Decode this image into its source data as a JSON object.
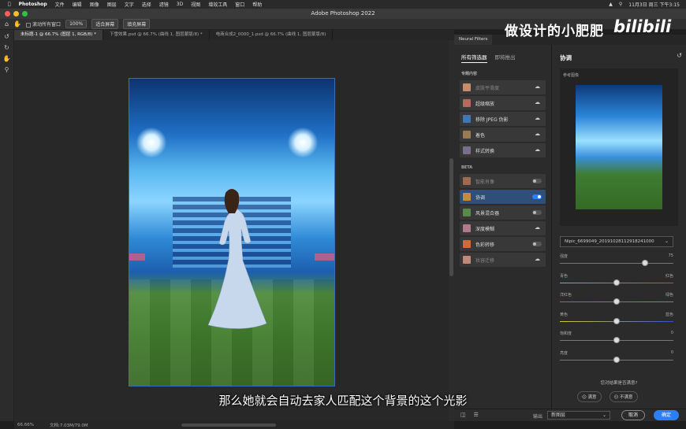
{
  "menubar": {
    "app": "Photoshop",
    "items": [
      "文件",
      "编辑",
      "图像",
      "图层",
      "文字",
      "选择",
      "滤镜",
      "3D",
      "视图",
      "增效工具",
      "窗口",
      "帮助"
    ],
    "clock": "11月3日 周三 下午3:15"
  },
  "window": {
    "title": "Adobe Photoshop 2022"
  },
  "options": {
    "scroll_all": "滚动所有窗口",
    "zoom": "100%",
    "fit_screen": "适合屏幕",
    "fill_screen": "填充屏幕"
  },
  "doc_tabs": [
    "未标题-1 @ 66.7% (图层 1, RGB/8) *",
    "下雪效果.psd @ 66.7% (曲线 1, 图层蒙版/8) *",
    "电商合成2_0000_1.psd @ 66.7% (曲线 1, 图层蒙版/8)"
  ],
  "status": {
    "zoom": "66.66%",
    "doc_size": "文档:7.03M/79.0M"
  },
  "neural": {
    "panel_tab": "Neural Filters",
    "tab_all": "所有筛选器",
    "tab_waitlist": "即将推出",
    "featured_label": "专题内容",
    "featured": [
      {
        "label": "皮肤平滑度",
        "thumb": "#c98c6a",
        "dim": true
      },
      {
        "label": "超级缩放",
        "thumb": "#b86a5a",
        "dim": false
      },
      {
        "label": "移除 JPEG 伪影",
        "thumb": "#3f78b5",
        "dim": false
      },
      {
        "label": "着色",
        "thumb": "#9a7a52",
        "dim": false
      },
      {
        "label": "样式转换",
        "thumb": "#7a6e8a",
        "dim": false
      }
    ],
    "beta_label": "BETA",
    "beta": [
      {
        "label": "智能肖像",
        "thumb": "#a06a50",
        "dim": true,
        "control": "toggle",
        "on": false
      },
      {
        "label": "协调",
        "thumb": "#c58a3a",
        "dim": false,
        "control": "toggle",
        "on": true,
        "selected": true
      },
      {
        "label": "风景混合器",
        "thumb": "#5a8a4a",
        "dim": false,
        "control": "toggle",
        "on": false
      },
      {
        "label": "深度模糊",
        "thumb": "#b07a8a",
        "dim": false,
        "control": "cloud"
      },
      {
        "label": "色彩转移",
        "thumb": "#d06a3a",
        "dim": false,
        "control": "toggle",
        "on": false
      },
      {
        "label": "妆容迁移",
        "thumb": "#c08a7a",
        "dim": true,
        "control": "cloud"
      }
    ],
    "detail_title": "协调",
    "reference_label": "参考图像",
    "reference_file": "Nipic_6699049_20191028112918241000",
    "sliders": [
      {
        "left": "强度",
        "right": "75",
        "value": 75,
        "min": 0,
        "max": 100
      },
      {
        "left": "青色",
        "right": "红色",
        "value": 0,
        "min": -50,
        "max": 50
      },
      {
        "left": "洋红色",
        "right": "绿色",
        "value": 0,
        "min": -50,
        "max": 50
      },
      {
        "left": "黄色",
        "right": "蓝色",
        "value": 0,
        "min": -50,
        "max": 50
      },
      {
        "left": "饱和度",
        "right": "0",
        "value": 0,
        "min": -50,
        "max": 50
      },
      {
        "left": "亮度",
        "right": "0",
        "value": 0,
        "min": -50,
        "max": 50
      }
    ],
    "feedback_q": "您对结果是否满意?",
    "fb_yes": "满意",
    "fb_no": "不满意",
    "output_label": "输出",
    "output_value": "新图层",
    "cancel": "取消",
    "ok": "确定"
  },
  "overlay": {
    "watermark": "做设计的小肥肥",
    "logo": "bilibili",
    "subtitle": "那么她就会自动去家人匹配这个背景的这个光影"
  }
}
